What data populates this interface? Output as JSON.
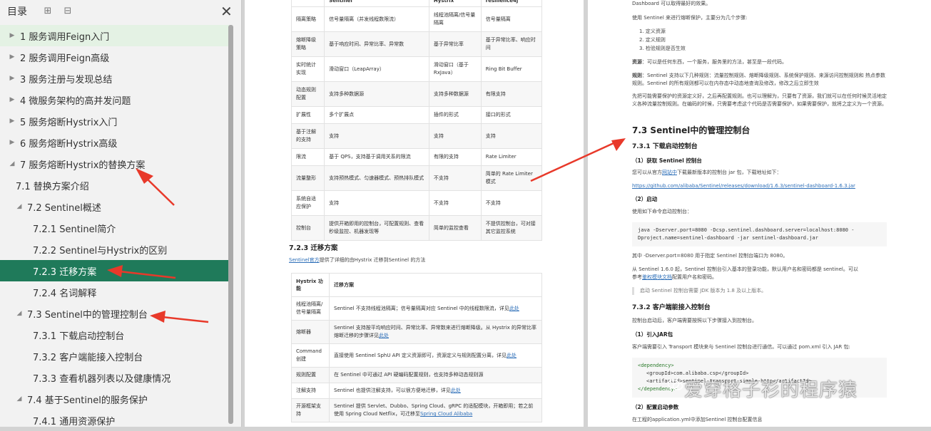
{
  "sidebar": {
    "title": "目录",
    "toc": [
      {
        "label": "1 服务调用Feign入门",
        "level": 0,
        "tri": "▶",
        "state": "hi"
      },
      {
        "label": "2 服务调用Feign高级",
        "level": 0,
        "tri": "▶",
        "state": ""
      },
      {
        "label": "3 服务注册与发现总结",
        "level": 0,
        "tri": "▶",
        "state": ""
      },
      {
        "label": "4 微服务架构的高并发问题",
        "level": 0,
        "tri": "▶",
        "state": ""
      },
      {
        "label": "5 服务熔断Hystrix入门",
        "level": 0,
        "tri": "▶",
        "state": ""
      },
      {
        "label": "6 服务熔断Hystrix高级",
        "level": 0,
        "tri": "▶",
        "state": ""
      },
      {
        "label": "7 服务熔断Hystrix的替换方案",
        "level": 0,
        "tri": "◢",
        "state": ""
      },
      {
        "label": "7.1 替换方案介绍",
        "level": 1,
        "tri": "",
        "state": ""
      },
      {
        "label": "7.2 Sentinel概述",
        "level": 1,
        "tri": "◢",
        "state": ""
      },
      {
        "label": "7.2.1 Sentinel简介",
        "level": 2,
        "tri": "",
        "state": ""
      },
      {
        "label": "7.2.2 Sentinel与Hystrix的区别",
        "level": 2,
        "tri": "",
        "state": ""
      },
      {
        "label": "7.2.3 迁移方案",
        "level": 2,
        "tri": "",
        "state": "active"
      },
      {
        "label": "7.2.4 名词解释",
        "level": 2,
        "tri": "",
        "state": ""
      },
      {
        "label": "7.3 Sentinel中的管理控制台",
        "level": 1,
        "tri": "◢",
        "state": ""
      },
      {
        "label": "7.3.1 下载启动控制台",
        "level": 2,
        "tri": "",
        "state": ""
      },
      {
        "label": "7.3.2 客户端能接入控制台",
        "level": 2,
        "tri": "",
        "state": ""
      },
      {
        "label": "7.3.3 查看机器列表以及健康情况",
        "level": 2,
        "tri": "",
        "state": ""
      },
      {
        "label": "7.4 基于Sentinel的服务保护",
        "level": 1,
        "tri": "◢",
        "state": ""
      },
      {
        "label": "7.4.1 通用资源保护",
        "level": 2,
        "tri": "",
        "state": ""
      }
    ]
  },
  "page1": {
    "compare_head": [
      "",
      "Sentinel",
      "Hystrix",
      "resilience4j"
    ],
    "compare_rows": [
      [
        "隔离策略",
        "信号量隔离（并发线程数限流）",
        "线程池隔离/信号量隔离",
        "信号量隔离"
      ],
      [
        "熔断降级策略",
        "基于响应时间、异常比率、异常数",
        "基于异常比率",
        "基于异常比率、响应时间"
      ],
      [
        "实时统计实现",
        "滑动窗口（LeapArray）",
        "滑动窗口（基于 RxJava）",
        "Ring Bit Buffer"
      ],
      [
        "动态规则配置",
        "支持多种数据源",
        "支持多种数据源",
        "有限支持"
      ],
      [
        "扩展性",
        "多个扩展点",
        "插件的形式",
        "接口的形式"
      ],
      [
        "基于注解的支持",
        "支持",
        "支持",
        "支持"
      ],
      [
        "限流",
        "基于 QPS，支持基于调用关系的限流",
        "有限的支持",
        "Rate Limiter"
      ],
      [
        "流量整形",
        "支持预热模式、匀速器模式、预热排队模式",
        "不支持",
        "简单的 Rate Limiter 模式"
      ],
      [
        "系统自适应保护",
        "支持",
        "不支持",
        "不支持"
      ],
      [
        "控制台",
        "提供开箱即用的控制台，可配置规则、查看秒级监控、机器发现等",
        "简单的监控查看",
        "不提供控制台，可对接其它监控系统"
      ]
    ],
    "section_title": "7.2.3 迁移方案",
    "intro_link": "Sentinel官方",
    "intro_text": "提供了详细的由Hystrix 迁移到Sentinel 的方法",
    "mig_head": [
      "Hystrix 功能",
      "迁移方案"
    ],
    "mig_rows": [
      {
        "k": "线程池隔离/信号量隔离",
        "v": "Sentinel 不支持线程池隔离；信号量隔离对应 Sentinel 中的线程数限流，详见",
        "l": "此处"
      },
      {
        "k": "熔断器",
        "v": "Sentinel 支持按平均响应时间、异常比率、异常数来进行熔断降级。从 Hystrix 的异常比率熔断迁移的步骤详见",
        "l": "此处"
      },
      {
        "k": "Command 创建",
        "v": "直接使用 Sentinel SphU API 定义资源即可，资源定义与规则配置分离，详见",
        "l": "此处"
      },
      {
        "k": "规则配置",
        "v": "在 Sentinel 中可通过 API 硬编码配置规则，也支持多种动态规则源",
        "l": ""
      },
      {
        "k": "注解支持",
        "v": "Sentinel 也提供注解支持，可以很方便地迁移，详见",
        "l": "此处"
      },
      {
        "k": "开源框架支持",
        "v": "Sentinel 提供 Servlet、Dubbo、Spring Cloud、gRPC 的适配模块，开箱即用；若之前使用 Spring Cloud Netflix，可迁移至",
        "l": "Spring Cloud Alibaba"
      }
    ]
  },
  "page2": {
    "line0": "Dashboard 可以取得最好的效果。",
    "line1": "使用 Sentinel 来进行熔断保护，主要分为几个步骤:",
    "steps": [
      "1. 定义资源",
      "2. 定义规则",
      "3. 检验规则是否生效"
    ],
    "res_label": "资源",
    "res_text": "：可以是任何东西，一个服务，服务里的方法，甚至是一段代码。",
    "rule_label": "规则",
    "rule_text": "：Sentinel 支持以下几种规则：流量控制规则、熔断降级规则、系统保护规则、来源访问控制规则和 热点参数规则。Sentinel 的所有规则都可以在内存态中动态地查询及修改，修改之后立即生效",
    "para3": "先把可能需要保护的资源定义好，之后再配置规则。也可以理解为，只要有了资源，我们就可以在任何时候灵活地定义各种流量控制规则。在编码的时候，只需要考虑这个代码是否需要保护，如果需要保护，就将之定义为一个资源。",
    "h_73": "7.3 Sentinel中的管理控制台",
    "h_731": "7.3.1 下载启动控制台",
    "s1": "（1）获取 Sentinel 控制台",
    "s1_text_a": "您可以从官方",
    "s1_link": "网站中",
    "s1_text_b": "下载最新版本的控制台 jar 包，下载地址如下：",
    "url": "https://github.com/alibaba/Sentinel/releases/download/1.6.3/sentinel-dashboard-1.6.3.jar",
    "s2": "（2）启动",
    "s2_text": "使用如下命令启动控制台：",
    "cmd1": "java -Dserver.port=8080 -Dcsp.sentinel.dashboard.server=localhost:8080 -",
    "cmd2": "Dproject.name=sentinel-dashboard -jar sentinel-dashboard.jar",
    "port_note": "其中 -Dserver.port=8080 用于指定 Sentinel 控制台端口为 8080。",
    "login_a": "从 Sentinel 1.6.0 起，Sentinel 控制台引入基本的登录功能，默认用户名和密码都是 sentinel。可以",
    "login_b": "参考",
    "login_link": "鉴权模块文档",
    "login_c": "配置用户名和密码。",
    "quote": "启动 Sentinel 控制台需要 JDK 版本为 1.8 及以上版本。",
    "h_732": "7.3.2 客户端能接入控制台",
    "client_text": "控制台启动后，客户端需要按照以下步骤接入到控制台。",
    "c1": "（1）引入JAR包",
    "c1_text": "客户端需要引入 Transport 模块来与 Sentinel 控制台进行通信。可以通过 pom.xml 引入 JAR 包:",
    "xml1": "<dependency>",
    "xml2": "<groupId>com.alibaba.csp</groupId>",
    "xml3": "<artifactId>sentinel-transport-simple-http</artifactId>",
    "xml4": "</dependency>",
    "c2": "（2）配置启动参数",
    "c2_text": "在工程的application.yml中添加Sentinel 控制台配置信息"
  },
  "watermark": "爱穿格子衫的程序猿"
}
